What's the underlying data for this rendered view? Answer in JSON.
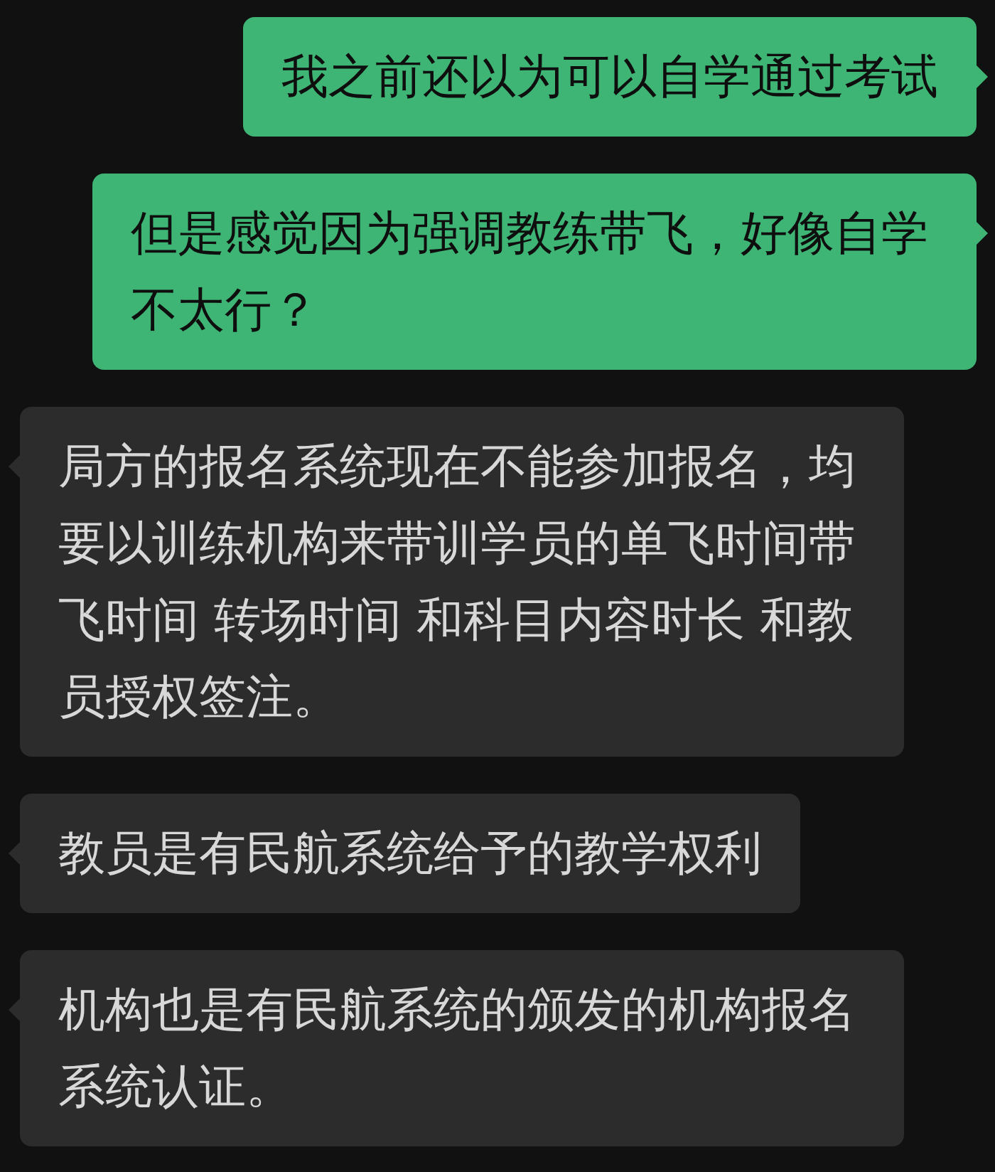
{
  "messages": [
    {
      "kind": "sent",
      "text": "我之前还以为可以自学通过考试"
    },
    {
      "kind": "sent",
      "text": "但是感觉因为强调教练带飞，好像自学不太行？"
    },
    {
      "kind": "received",
      "text": "局方的报名系统现在不能参加报名，均要以训练机构来带训学员的单飞时间带飞时间 转场时间 和科目内容时长 和教员授权签注。"
    },
    {
      "kind": "received",
      "text": "教员是有民航系统给予的教学权利"
    },
    {
      "kind": "received",
      "text": "机构也是有民航系统的颁发的机构报名系统认证。"
    }
  ]
}
